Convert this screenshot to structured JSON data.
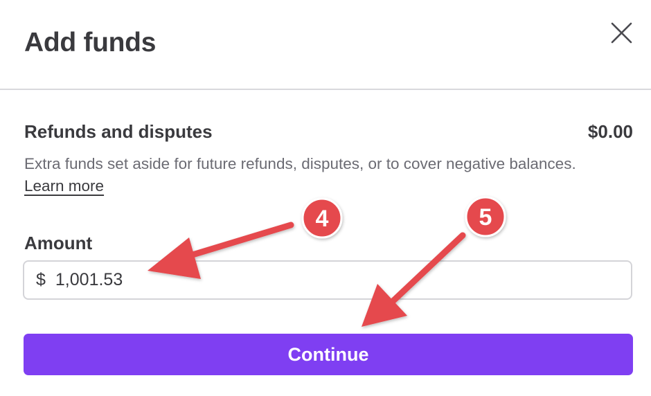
{
  "modal": {
    "title": "Add funds",
    "close_icon": "close-icon"
  },
  "reserve": {
    "title": "Refunds and disputes",
    "amount": "$0.00",
    "description": "Extra funds set aside for future refunds, disputes, or to cover negative balances.",
    "learn_more": "Learn more"
  },
  "amount": {
    "label": "Amount",
    "currency_symbol": "$",
    "value": "1,001.53"
  },
  "continue_label": "Continue",
  "annotations": [
    {
      "step": "4",
      "color": "#e5484d"
    },
    {
      "step": "5",
      "color": "#e5484d"
    }
  ],
  "colors": {
    "primary": "#7f3ff2",
    "annotation": "#e5484d",
    "text": "#3a3a3e",
    "muted": "#6b6b73",
    "divider": "#d8d8dc"
  }
}
